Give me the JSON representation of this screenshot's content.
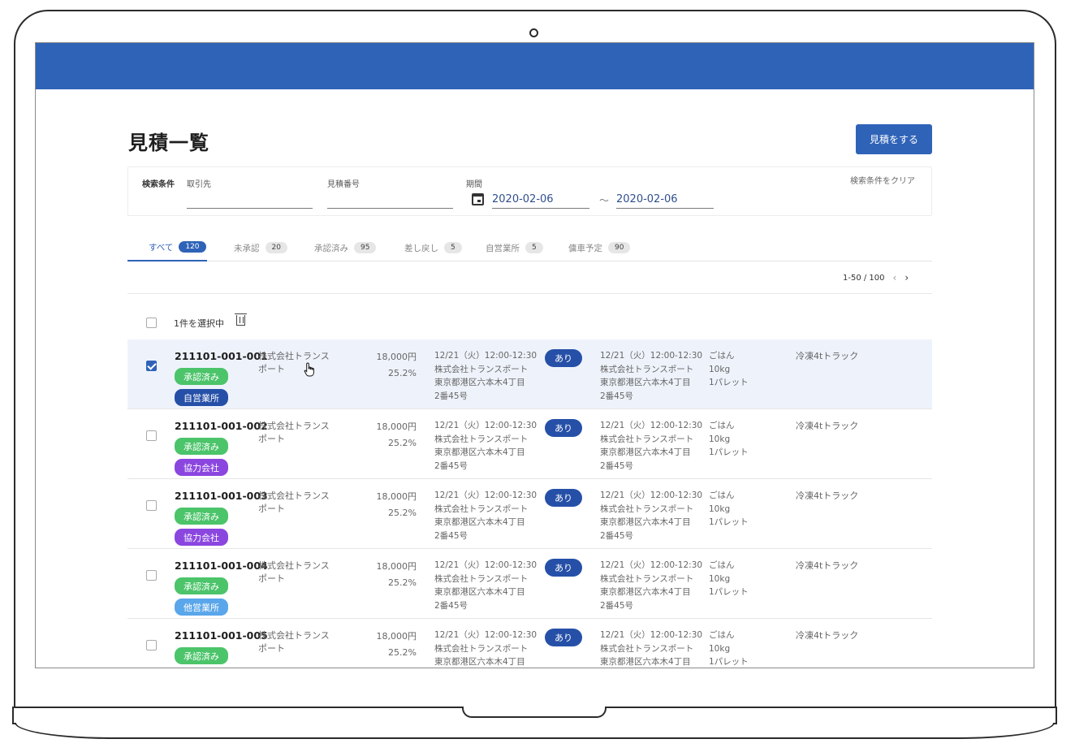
{
  "header": {
    "title": "見積一覧",
    "create_button": "見積をする"
  },
  "search": {
    "label": "検索条件",
    "client_label": "取引先",
    "estimate_no_label": "見積番号",
    "period_label": "期間",
    "date_from": "2020-02-06",
    "date_to": "2020-02-06",
    "range_sep": "～",
    "clear_label": "検索条件をクリア"
  },
  "tabs": [
    {
      "label": "すべて",
      "count": "120"
    },
    {
      "label": "未承認",
      "count": "20"
    },
    {
      "label": "承認済み",
      "count": "95"
    },
    {
      "label": "差し戻し",
      "count": "5"
    },
    {
      "label": "自営業所",
      "count": "5"
    },
    {
      "label": "傭車予定",
      "count": "90"
    }
  ],
  "pagination": {
    "range": "1-50 / 100",
    "prev": "‹",
    "next": "›"
  },
  "selection": {
    "text": "1件を選択中"
  },
  "rows": [
    {
      "id": "211101-001-001",
      "status": "承認済み",
      "office": "自営業所",
      "company": "株式会社トランスポート",
      "price": "18,000円",
      "rate": "25.2%",
      "pickup": [
        "12/21（火）12:00-12:30",
        "株式会社トランスポート",
        "東京都港区六本木4丁目",
        "2番45号"
      ],
      "flag": "あり",
      "delivery": [
        "12/21（火）12:00-12:30",
        "株式会社トランスポート",
        "東京都港区六本木4丁目",
        "2番45号"
      ],
      "cargo": [
        "ごはん",
        "10kg",
        "1パレット"
      ],
      "vehicle": "冷凍4tトラック"
    },
    {
      "id": "211101-001-002",
      "status": "承認済み",
      "office": "協力会社",
      "company": "株式会社トランスポート",
      "price": "18,000円",
      "rate": "25.2%",
      "pickup": [
        "12/21（火）12:00-12:30",
        "株式会社トランスポート",
        "東京都港区六本木4丁目",
        "2番45号"
      ],
      "flag": "あり",
      "delivery": [
        "12/21（火）12:00-12:30",
        "株式会社トランスポート",
        "東京都港区六本木4丁目",
        "2番45号"
      ],
      "cargo": [
        "ごはん",
        "10kg",
        "1パレット"
      ],
      "vehicle": "冷凍4tトラック"
    },
    {
      "id": "211101-001-003",
      "status": "承認済み",
      "office": "協力会社",
      "company": "株式会社トランスポート",
      "price": "18,000円",
      "rate": "25.2%",
      "pickup": [
        "12/21（火）12:00-12:30",
        "株式会社トランスポート",
        "東京都港区六本木4丁目",
        "2番45号"
      ],
      "flag": "あり",
      "delivery": [
        "12/21（火）12:00-12:30",
        "株式会社トランスポート",
        "東京都港区六本木4丁目",
        "2番45号"
      ],
      "cargo": [
        "ごはん",
        "10kg",
        "1パレット"
      ],
      "vehicle": "冷凍4tトラック"
    },
    {
      "id": "211101-001-004",
      "status": "承認済み",
      "office": "他営業所",
      "company": "株式会社トランスポート",
      "price": "18,000円",
      "rate": "25.2%",
      "pickup": [
        "12/21（火）12:00-12:30",
        "株式会社トランスポート",
        "東京都港区六本木4丁目",
        "2番45号"
      ],
      "flag": "あり",
      "delivery": [
        "12/21（火）12:00-12:30",
        "株式会社トランスポート",
        "東京都港区六本木4丁目",
        "2番45号"
      ],
      "cargo": [
        "ごはん",
        "10kg",
        "1パレット"
      ],
      "vehicle": "冷凍4tトラック"
    },
    {
      "id": "211101-001-005",
      "status": "承認済み",
      "company": "株式会社トランスポート",
      "price": "18,000円",
      "rate": "25.2%",
      "pickup": [
        "12/21（火）12:00-12:30",
        "株式会社トランスポート",
        "東京都港区六本木4丁目"
      ],
      "flag": "あり",
      "delivery": [
        "12/21（火）12:00-12:30",
        "株式会社トランスポート",
        "東京都港区六本木4丁目"
      ],
      "cargo": [
        "ごはん",
        "10kg",
        "1パレット"
      ],
      "vehicle": "冷凍4tトラック"
    }
  ],
  "colors": {
    "brand": "#2f63b8",
    "approved": "#4cc46a",
    "own_office": "#2650a8",
    "partner": "#8b46e0",
    "other_office": "#5aa6ea"
  }
}
